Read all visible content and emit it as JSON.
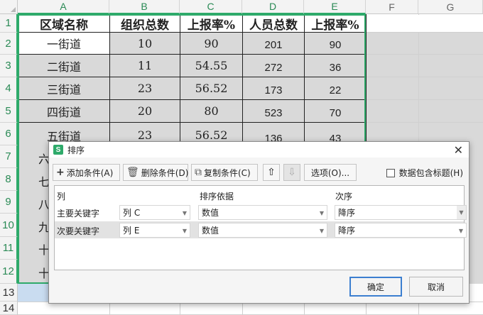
{
  "sheet": {
    "columns": [
      "A",
      "B",
      "C",
      "D",
      "E",
      "F",
      "G"
    ],
    "rows": [
      "1",
      "2",
      "3",
      "4",
      "5",
      "6",
      "7",
      "8",
      "9",
      "10",
      "11",
      "12",
      "13",
      "14"
    ],
    "headers": [
      "区域名称",
      "组织总数",
      "上报率%",
      "人员总数",
      "上报率%"
    ],
    "data": [
      [
        "一街道",
        "10",
        "90",
        "201",
        "90"
      ],
      [
        "二街道",
        "11",
        "54.55",
        "272",
        "36"
      ],
      [
        "三街道",
        "23",
        "56.52",
        "173",
        "22"
      ],
      [
        "四街道",
        "20",
        "80",
        "523",
        "70"
      ],
      [
        "五街道",
        "23",
        "56.52",
        "136",
        "43"
      ]
    ],
    "partial_col_a": [
      "六",
      "七",
      "八",
      "九",
      "十",
      "十"
    ]
  },
  "dialog": {
    "title": "排序",
    "app_icon": "S",
    "toolbar": {
      "add": "添加条件(A)",
      "delete": "删除条件(D)",
      "copy": "复制条件(C)",
      "options": "选项(O)...",
      "header_checkbox": "数据包含标题(H)"
    },
    "grid": {
      "col_headers": [
        "列",
        "排序依据",
        "次序"
      ],
      "rows": [
        {
          "label": "主要关键字",
          "column": "列 C",
          "basis": "数值",
          "order": "降序"
        },
        {
          "label": "次要关键字",
          "column": "列 E",
          "basis": "数值",
          "order": "降序"
        }
      ]
    },
    "ok": "确定",
    "cancel": "取消"
  },
  "colors": {
    "accent_green": "#2eaa6a",
    "selection_gray": "#d9d9d9",
    "focus_blue": "#3c7fd0"
  }
}
